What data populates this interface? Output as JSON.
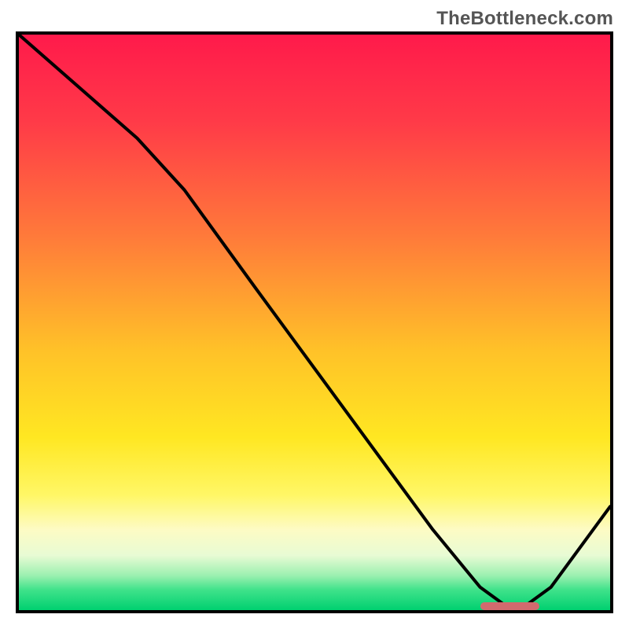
{
  "watermark": "TheBottleneck.com",
  "colors": {
    "gradient_stops": [
      {
        "offset": 0.0,
        "color": "#ff1a4b"
      },
      {
        "offset": 0.15,
        "color": "#ff3a48"
      },
      {
        "offset": 0.35,
        "color": "#ff7a3a"
      },
      {
        "offset": 0.55,
        "color": "#ffc228"
      },
      {
        "offset": 0.7,
        "color": "#ffe722"
      },
      {
        "offset": 0.8,
        "color": "#fff766"
      },
      {
        "offset": 0.86,
        "color": "#fdfbc4"
      },
      {
        "offset": 0.905,
        "color": "#e8fbd4"
      },
      {
        "offset": 0.94,
        "color": "#9bf0b0"
      },
      {
        "offset": 0.965,
        "color": "#3fe28a"
      },
      {
        "offset": 1.0,
        "color": "#00d070"
      }
    ],
    "curve": "#000000",
    "marker": "#d26a6e",
    "border": "#000000"
  },
  "chart_data": {
    "type": "line",
    "title": "",
    "xlabel": "",
    "ylabel": "",
    "xlim": [
      0,
      100
    ],
    "ylim": [
      0,
      100
    ],
    "x": [
      0,
      10,
      20,
      28,
      40,
      50,
      60,
      70,
      78,
      82,
      86,
      90,
      100
    ],
    "values": [
      100,
      91,
      82,
      73,
      56,
      42,
      28,
      14,
      4,
      1,
      1,
      4,
      18
    ],
    "marker": {
      "x_start": 78,
      "x_end": 88,
      "y": 0.7,
      "thickness": 1.4
    },
    "note": "x and y are in percent of the plot area. y=100 at top, y=0 at bottom (bottleneck-free). Curve shows bottleneck score descending to a minimum near x≈84 then rising."
  }
}
